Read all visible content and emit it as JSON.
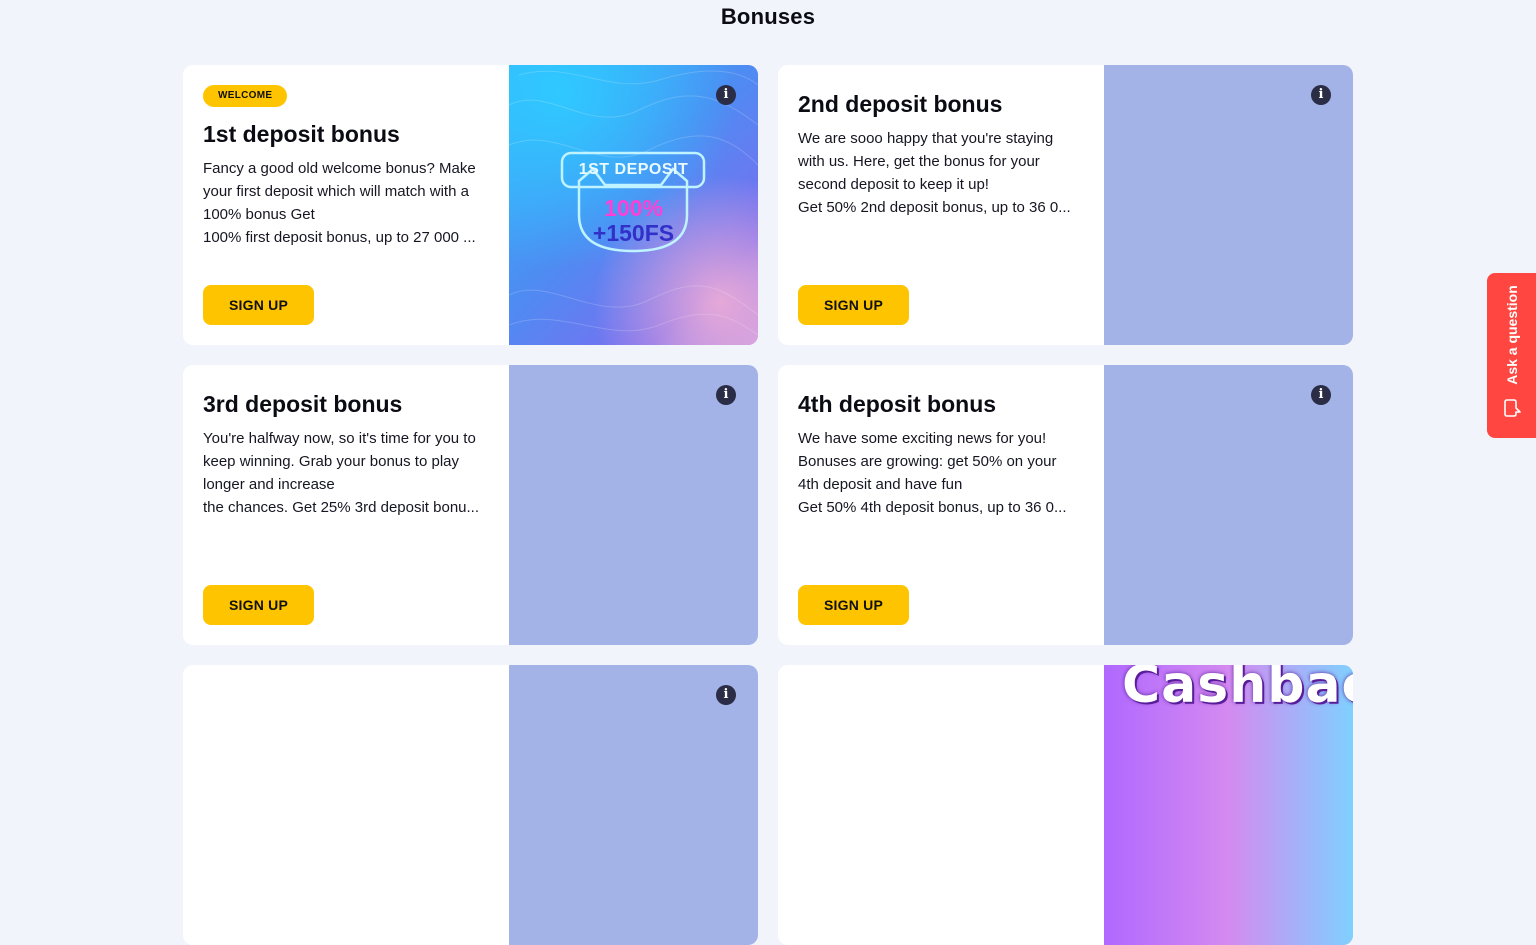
{
  "page": {
    "title": "Bonuses"
  },
  "cards": [
    {
      "badge": "WELCOME",
      "title": "1st deposit bonus",
      "desc": [
        "Fancy a good old welcome bonus? Make",
        "your first deposit which will match with a",
        "100% bonus Get",
        "100% first deposit bonus, up to 27 000 ..."
      ],
      "button": "SIGN UP",
      "art": {
        "heading": "1ST DEPOSIT",
        "line1": "100%",
        "line2": "+150FS"
      }
    },
    {
      "title": "2nd deposit bonus",
      "desc": [
        "We are sooo happy that you're staying",
        "with us. Here, get the bonus for your",
        "second deposit to keep it up!",
        "Get 50% 2nd deposit bonus, up to 36 0..."
      ],
      "button": "SIGN UP"
    },
    {
      "title": "3rd deposit bonus",
      "desc": [
        "You're halfway now, so it's time for you to",
        "keep winning. Grab your bonus to play",
        "longer and increase",
        "the chances. Get 25% 3rd deposit bonu..."
      ],
      "button": "SIGN UP"
    },
    {
      "title": "4th deposit bonus",
      "desc": [
        "We have some exciting news for you!",
        "Bonuses are growing: get 50% on your",
        "4th deposit and have fun",
        "Get 50% 4th deposit bonus, up to 36 0..."
      ],
      "button": "SIGN UP"
    },
    {
      "title": "",
      "desc": [],
      "button": ""
    },
    {
      "title": "",
      "desc": [],
      "button": "",
      "art": {
        "word": "Cashback"
      }
    }
  ],
  "ask_tab": {
    "label": "Ask a question",
    "icon": "chat-bubble-icon"
  },
  "colors": {
    "accent": "#ffc400",
    "media_placeholder": "#a3b3e7",
    "ask_tab": "#ff4640",
    "background": "#f1f4fb"
  }
}
